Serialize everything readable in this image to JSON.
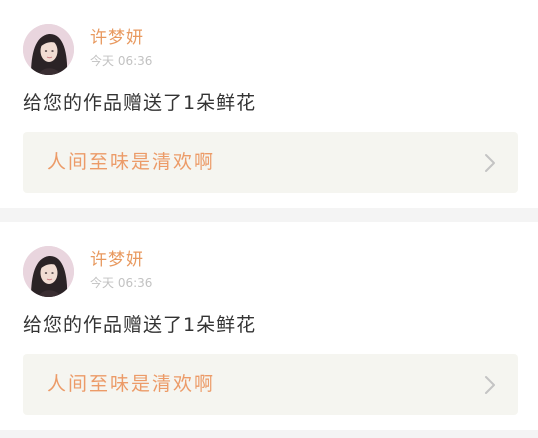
{
  "notifications": [
    {
      "username": "许梦妍",
      "time": "今天 06:36",
      "message": "给您的作品赠送了1朵鲜花",
      "work_title": "人间至味是清欢啊",
      "avatar_icon": "user-avatar-photo",
      "chevron_icon": "chevron-right-icon"
    },
    {
      "username": "许梦妍",
      "time": "今天 06:36",
      "message": "给您的作品赠送了1朵鲜花",
      "work_title": "人间至味是清欢啊",
      "avatar_icon": "user-avatar-photo",
      "chevron_icon": "chevron-right-icon"
    }
  ],
  "colors": {
    "username": "#e8995f",
    "work_title": "#ec9b68",
    "message": "#333333",
    "timestamp": "#c2c2c2",
    "work_link_bg": "#f5f5f0",
    "divider": "#f4f4f4"
  }
}
